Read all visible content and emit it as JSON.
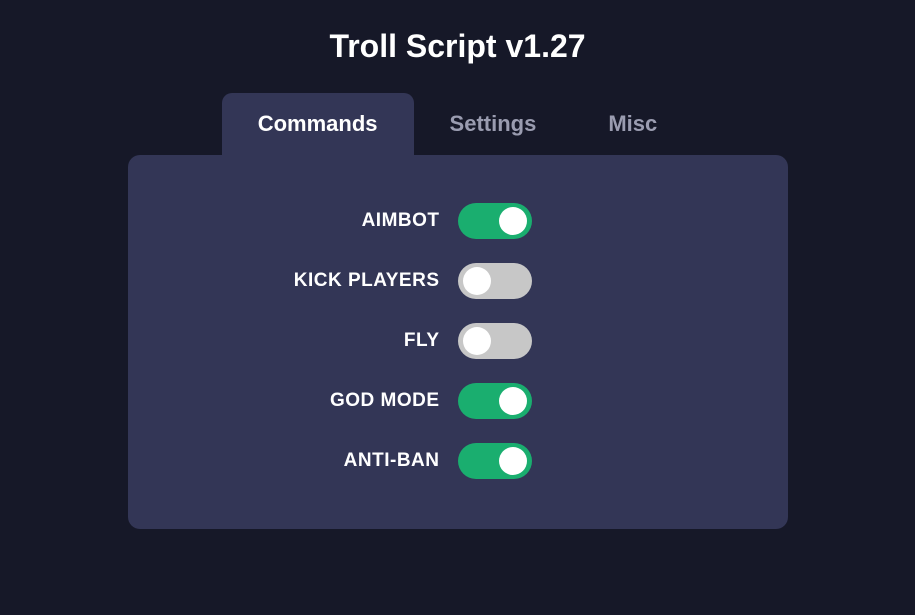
{
  "title": "Troll Script v1.27",
  "tabs": [
    {
      "label": "Commands",
      "active": true
    },
    {
      "label": "Settings",
      "active": false
    },
    {
      "label": "Misc",
      "active": false
    }
  ],
  "commands": [
    {
      "label": "AIMBOT",
      "enabled": true
    },
    {
      "label": "KICK PLAYERS",
      "enabled": false
    },
    {
      "label": "FLY",
      "enabled": false
    },
    {
      "label": "GOD MODE",
      "enabled": true
    },
    {
      "label": "ANTI-BAN",
      "enabled": true
    }
  ]
}
